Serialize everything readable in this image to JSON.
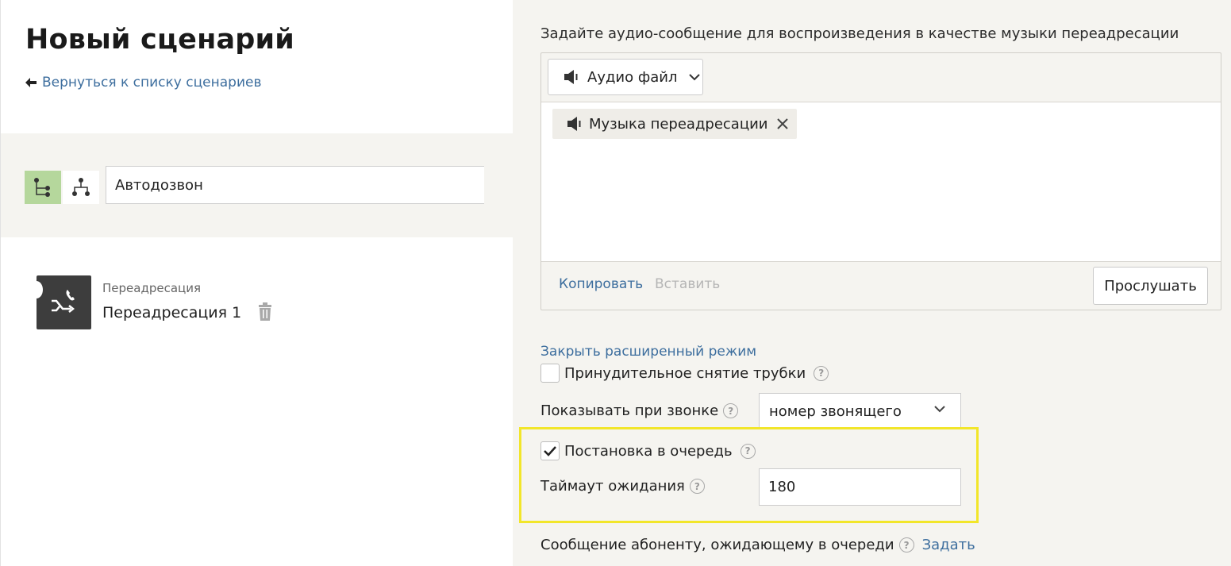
{
  "header": {
    "title": "Новый сценарий",
    "back_link": "Вернуться к списку сценариев"
  },
  "scenario": {
    "name": "Автодозвон"
  },
  "node": {
    "type": "Переадресация",
    "name": "Переадресация 1"
  },
  "audio": {
    "label": "Задайте аудио-сообщение для воспроизведения в качестве музыки переадресации",
    "type_button": "Аудио файл",
    "tag": "Музыка переадресации",
    "copy": "Копировать",
    "paste": "Вставить",
    "listen": "Прослушать"
  },
  "advanced": {
    "close_link": "Закрыть расширенный режим",
    "forced_pickup_label": "Принудительное снятие трубки",
    "forced_pickup_checked": false,
    "show_on_call_label": "Показывать при звонке",
    "show_on_call_value": "номер звонящего",
    "queue_label": "Постановка в очередь",
    "queue_checked": true,
    "timeout_label": "Таймаут ожидания",
    "timeout_value": "180",
    "queue_message_label": "Сообщение абоненту, ожидающему в очереди",
    "queue_message_link": "Задать"
  },
  "colors": {
    "link": "#3d6e9e",
    "highlight": "#f2e62a",
    "tree_active": "#b5d79c",
    "panel_bg": "#f5f4f0"
  }
}
